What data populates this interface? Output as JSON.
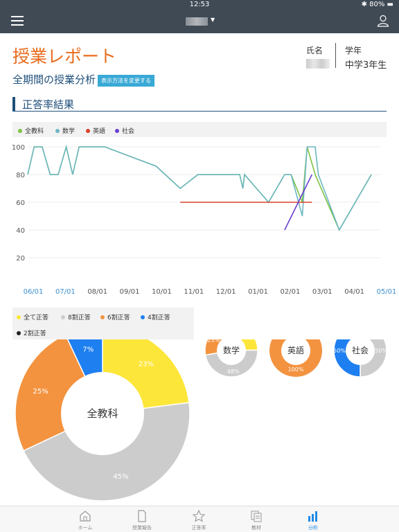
{
  "status": {
    "time": "12:53",
    "battery": "80%"
  },
  "report": {
    "title": "授業レポート",
    "name_label": "氏名",
    "grade_label": "学年",
    "grade_value": "中学3年生",
    "analysis_title": "全期間の授業分析",
    "change_button": "表示方法を変更する",
    "section_title": "正答率結果"
  },
  "colors": {
    "all": "#7dc242",
    "math": "#6cb6c2",
    "english": "#d9412e",
    "social": "#6a3fd0"
  },
  "line_legend": [
    "全教科",
    "数学",
    "英語",
    "社会"
  ],
  "chart_data": [
    {
      "type": "line",
      "x": [
        "06/01",
        "07/01",
        "08/01",
        "09/01",
        "10/01",
        "11/01",
        "12/01",
        "01/01",
        "02/01",
        "03/01",
        "04/01",
        "05/01"
      ],
      "ylim": [
        20,
        100
      ],
      "yticks": [
        20,
        40,
        60,
        80,
        100
      ],
      "series": [
        {
          "name": "全教科",
          "points": [
            [
              0,
              80
            ],
            [
              0.2,
              100
            ],
            [
              0.45,
              100
            ],
            [
              0.7,
              80
            ],
            [
              0.95,
              80
            ],
            [
              1.2,
              100
            ],
            [
              1.4,
              80
            ],
            [
              1.6,
              100
            ],
            [
              2.4,
              100
            ],
            [
              4.0,
              86
            ],
            [
              4.75,
              70
            ],
            [
              5.3,
              80
            ],
            [
              6.6,
              80
            ],
            [
              6.7,
              70
            ],
            [
              6.75,
              80
            ],
            [
              7.5,
              60
            ],
            [
              8.0,
              80
            ],
            [
              8.2,
              80
            ],
            [
              8.55,
              60
            ],
            [
              8.7,
              100
            ],
            [
              8.95,
              80
            ],
            [
              9.7,
              40
            ],
            [
              10.7,
              80
            ]
          ]
        },
        {
          "name": "数学",
          "points": [
            [
              0,
              80
            ],
            [
              0.2,
              100
            ],
            [
              0.45,
              100
            ],
            [
              0.7,
              80
            ],
            [
              0.95,
              80
            ],
            [
              1.2,
              100
            ],
            [
              1.4,
              80
            ],
            [
              1.6,
              100
            ],
            [
              2.4,
              100
            ],
            [
              4.0,
              86
            ],
            [
              4.75,
              70
            ],
            [
              5.3,
              80
            ],
            [
              6.6,
              80
            ],
            [
              6.7,
              70
            ],
            [
              6.75,
              80
            ],
            [
              7.5,
              60
            ],
            [
              8.0,
              80
            ],
            [
              8.2,
              80
            ],
            [
              8.55,
              50
            ],
            [
              8.7,
              100
            ],
            [
              8.95,
              100
            ],
            [
              9.05,
              80
            ],
            [
              9.7,
              40
            ],
            [
              10.7,
              80
            ]
          ]
        },
        {
          "name": "英語",
          "points": [
            [
              4.75,
              60
            ],
            [
              8.85,
              60
            ]
          ]
        },
        {
          "name": "社会",
          "points": [
            [
              8.0,
              40
            ],
            [
              8.85,
              80
            ]
          ]
        }
      ]
    },
    {
      "type": "pie",
      "title": "全教科",
      "legend": [
        "全て正答",
        "8割正答",
        "6割正答",
        "4割正答",
        "2割正答"
      ],
      "slices": [
        {
          "label": "全て正答",
          "value": 23,
          "color": "#fde63a"
        },
        {
          "label": "8割正答",
          "value": 45,
          "color": "#cccccc"
        },
        {
          "label": "6割正答",
          "value": 25,
          "color": "#f39340"
        },
        {
          "label": "4割正答",
          "value": 7,
          "color": "#1e7ff0"
        }
      ]
    },
    {
      "type": "pie",
      "title": "数学",
      "slices": [
        {
          "label": "全て正答",
          "value": 25,
          "color": "#fde63a"
        },
        {
          "label": "8割正答",
          "value": 48,
          "color": "#cccccc"
        },
        {
          "label": "6割正答",
          "value": 23,
          "color": "#f39340"
        },
        {
          "label": "4割正答",
          "value": 5,
          "color": "#1e7ff0"
        }
      ]
    },
    {
      "type": "pie",
      "title": "英語",
      "slices": [
        {
          "label": "6割正答",
          "value": 100,
          "color": "#f39340"
        }
      ]
    },
    {
      "type": "pie",
      "title": "社会",
      "slices": [
        {
          "label": "8割正答",
          "value": 50,
          "color": "#cccccc"
        },
        {
          "label": "4割正答",
          "value": 50,
          "color": "#1e7ff0"
        }
      ]
    }
  ],
  "tabs": [
    {
      "label": "ホーム",
      "icon": "home-icon"
    },
    {
      "label": "授業報告",
      "icon": "document-icon"
    },
    {
      "label": "正答率",
      "icon": "star-icon"
    },
    {
      "label": "教材",
      "icon": "materials-icon"
    },
    {
      "label": "分析",
      "icon": "bar-chart-icon"
    }
  ]
}
